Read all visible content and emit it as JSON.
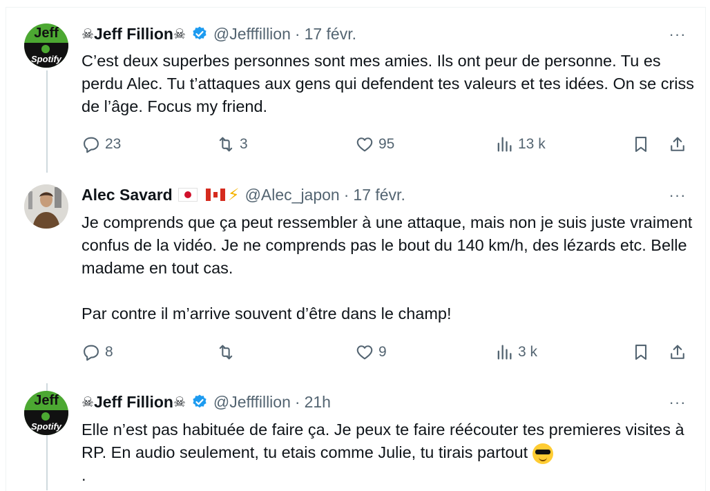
{
  "tweets": [
    {
      "author": {
        "name": "Jeff Fillion",
        "name_prefix_emoji": "☠",
        "name_suffix_emoji": "☠",
        "handle": "@Jefffillion",
        "verified": true,
        "avatar_top_text": "Jeff",
        "avatar_brand_text": "Spotify"
      },
      "time": "17 févr.",
      "text": "C’est deux superbes personnes sont mes amies. Ils ont peur de personne. Tu es perdu Alec. Tu t’attaques aux gens qui defendent tes valeurs et tes idées. On se criss de l’âge. Focus my friend.",
      "stats": {
        "replies": "23",
        "retweets": "3",
        "likes": "95",
        "views": "13 k"
      }
    },
    {
      "author": {
        "name": "Alec Savard",
        "handle": "@Alec_japon",
        "verified": false,
        "flags": [
          "japan-flag",
          "canada-flag"
        ],
        "bolt_emoji": "⚡"
      },
      "time": "17 févr.",
      "text": "Je comprends que ça peut ressembler à une attaque, mais non je suis juste vraiment confus de la vidéo. Je ne comprends pas le bout du 140 km/h, des lézards etc. Belle madame en tout cas.\n\nPar contre il m’arrive souvent d’être dans le champ!",
      "stats": {
        "replies": "8",
        "retweets": "",
        "likes": "9",
        "views": "3 k"
      }
    },
    {
      "author": {
        "name": "Jeff Fillion",
        "name_prefix_emoji": "☠",
        "name_suffix_emoji": "☠",
        "handle": "@Jefffillion",
        "verified": true,
        "avatar_top_text": "Jeff",
        "avatar_brand_text": "Spotify"
      },
      "time": "21h",
      "text": "Elle n’est pas habituée de faire ça. Je peux te faire réécouter tes premieres visites à RP. En audio seulement, tu etais comme Julie, tu tirais partout",
      "text_tail": "."
    }
  ],
  "ui": {
    "dot_separator": "·",
    "more_label": "···"
  },
  "colors": {
    "text": "#0f1419",
    "secondary": "#536471",
    "verified_blue": "#1d9bf0",
    "thread_line": "#cfd9de"
  }
}
